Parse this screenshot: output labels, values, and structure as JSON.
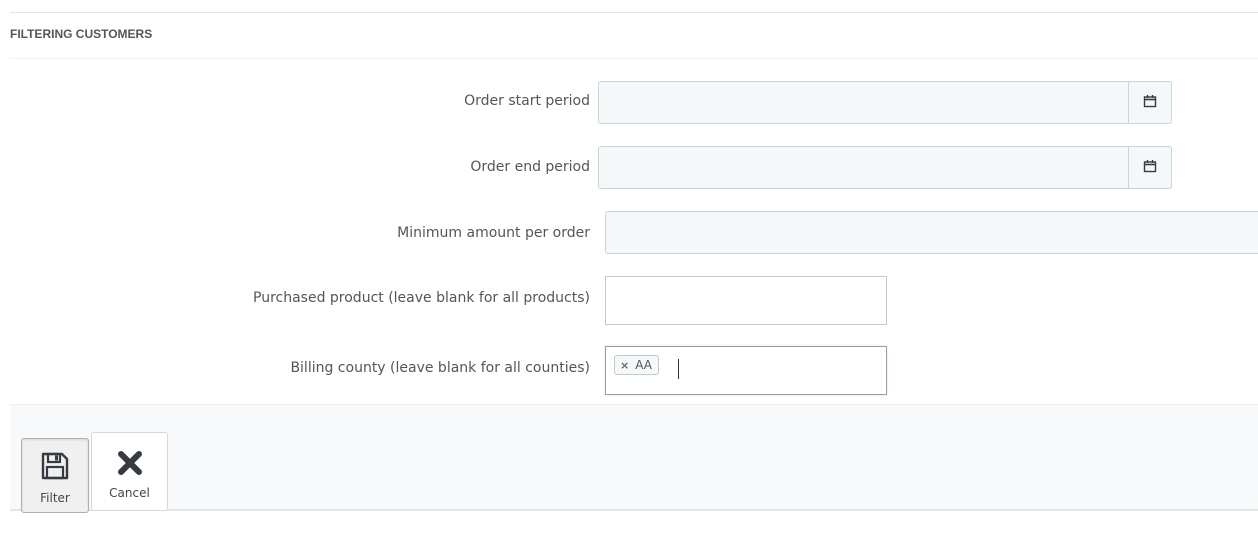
{
  "panel": {
    "title": "FILTERING CUSTOMERS"
  },
  "form": {
    "order_start": {
      "label": "Order start period",
      "value": "",
      "icon": "calendar-icon"
    },
    "order_end": {
      "label": "Order end period",
      "value": "",
      "icon": "calendar-icon"
    },
    "min_amount": {
      "label": "Minimum amount per order",
      "value": ""
    },
    "purchased_product": {
      "label": "Purchased product (leave blank for all products)",
      "value": ""
    },
    "billing_county": {
      "label": "Billing county (leave blank for all counties)",
      "tags": [
        {
          "remove": "×",
          "text": "AA"
        }
      ]
    }
  },
  "footer": {
    "filter_label": "Filter",
    "cancel_label": "Cancel"
  }
}
